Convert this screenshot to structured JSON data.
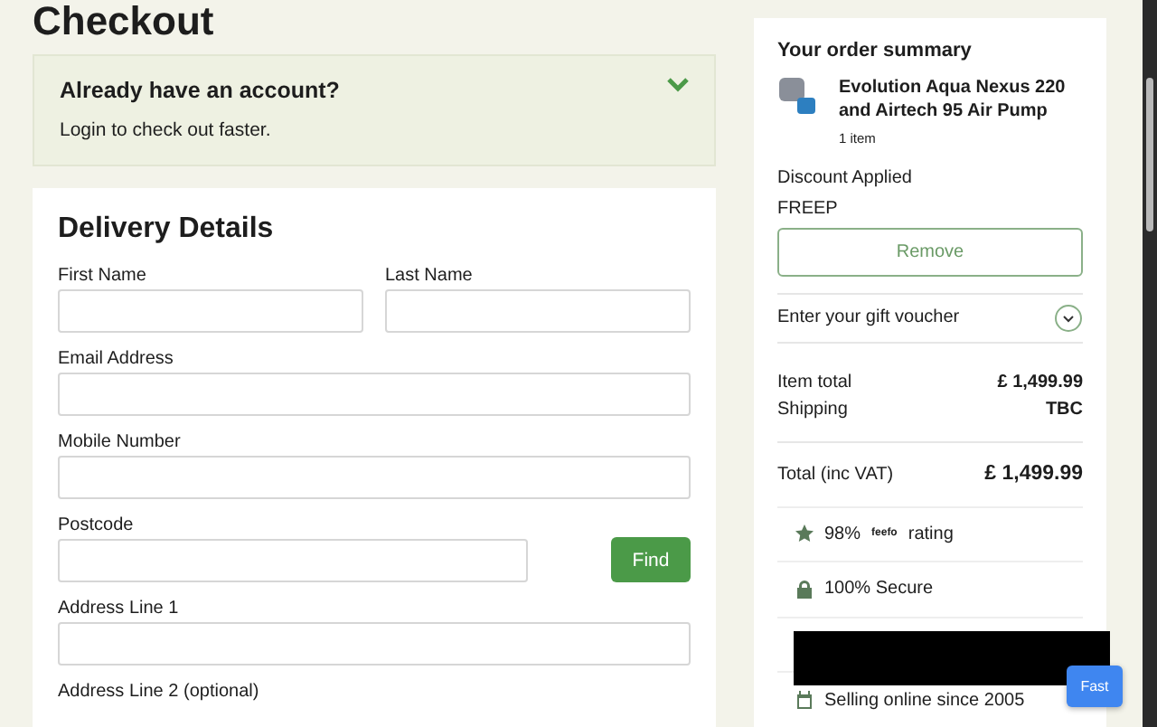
{
  "page": {
    "title": "Checkout"
  },
  "account": {
    "title": "Already have an account?",
    "text": "Login to check out faster.",
    "expanded": false
  },
  "delivery": {
    "title": "Delivery Details",
    "fields": [
      {
        "kind": "pair",
        "fields": [
          {
            "label": "First Name"
          },
          {
            "label": "Last Name"
          }
        ]
      },
      {
        "kind": "single",
        "label": "Email Address"
      },
      {
        "kind": "single",
        "label": "Mobile Number"
      },
      {
        "kind": "lookup",
        "label": "Postcode",
        "button": "Find"
      },
      {
        "kind": "single",
        "label": "Address Line 1"
      },
      {
        "kind": "label",
        "label": "Address Line 2 (optional)"
      }
    ]
  },
  "summary": {
    "title": "Your order summary",
    "product": {
      "name": "Evolution Aqua Nexus 220 and Airtech 95 Air Pump",
      "count": "1 item"
    },
    "discount_label": "Discount Applied",
    "discount_code": "FREEP",
    "remove_button": "Remove",
    "voucher": "Enter your gift voucher",
    "rows": [
      {
        "label": "Item total",
        "value": "£ 1,499.99"
      },
      {
        "label": "Shipping",
        "value": "TBC"
      }
    ],
    "total": {
      "label": "Total (inc VAT)",
      "value": "£ 1,499.99"
    },
    "trust": [
      {
        "kind": "rating",
        "before": "98%",
        "brand": "feefo",
        "after": "rating"
      },
      {
        "kind": "secure",
        "text": "100% Secure"
      },
      {
        "kind": "hidden"
      },
      {
        "kind": "since",
        "text": "Selling online since 2005"
      }
    ]
  },
  "chat_button": "Fast"
}
